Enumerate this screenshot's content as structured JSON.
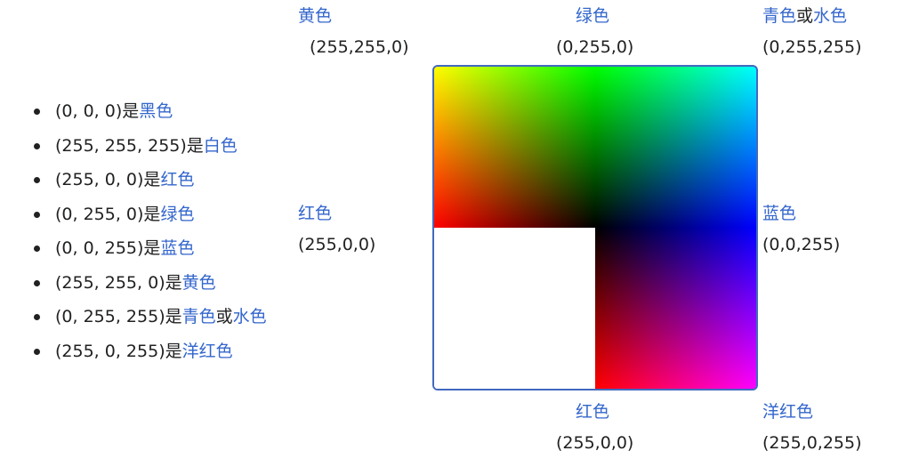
{
  "list": [
    {
      "prefix": "(0, 0, 0)是",
      "links": [
        "黑色"
      ],
      "connector": ""
    },
    {
      "prefix": "(255, 255, 255)是",
      "links": [
        "白色"
      ],
      "connector": ""
    },
    {
      "prefix": "(255, 0, 0)是",
      "links": [
        "红色"
      ],
      "connector": ""
    },
    {
      "prefix": "(0, 255, 0)是",
      "links": [
        "绿色"
      ],
      "connector": ""
    },
    {
      "prefix": "(0, 0, 255)是",
      "links": [
        "蓝色"
      ],
      "connector": ""
    },
    {
      "prefix": "(255, 255, 0)是",
      "links": [
        "黄色"
      ],
      "connector": ""
    },
    {
      "prefix": "(0, 255, 255)是",
      "links": [
        "青色",
        "水色"
      ],
      "connector": "或"
    },
    {
      "prefix": "(255, 0, 255)是",
      "links": [
        "洋红色"
      ],
      "connector": ""
    }
  ],
  "labels": {
    "yellow": {
      "name": "黄色",
      "rgb": "(255,255,0)"
    },
    "green_top": {
      "name": "绿色",
      "rgb": "(0,255,0)"
    },
    "cyan": {
      "name_a": "青色",
      "connector": "或",
      "name_b": "水色",
      "rgb": "(0,255,255)"
    },
    "red_left": {
      "name": "红色",
      "rgb": "(255,0,0)"
    },
    "blue": {
      "name": "蓝色",
      "rgb": "(0,0,255)"
    },
    "red_bottom": {
      "name": "红色",
      "rgb": "(255,0,0)"
    },
    "magenta": {
      "name": "洋红色",
      "rgb": "(255,0,255)"
    }
  },
  "colors": {
    "link": "#3366cc",
    "frame": "#4169bf",
    "yellow": "#ffff00",
    "green": "#00ff00",
    "cyan": "#00ffff",
    "red": "#ff0000",
    "blue": "#0000ff",
    "magenta": "#ff00ff",
    "black": "#000000",
    "white": "#ffffff"
  }
}
